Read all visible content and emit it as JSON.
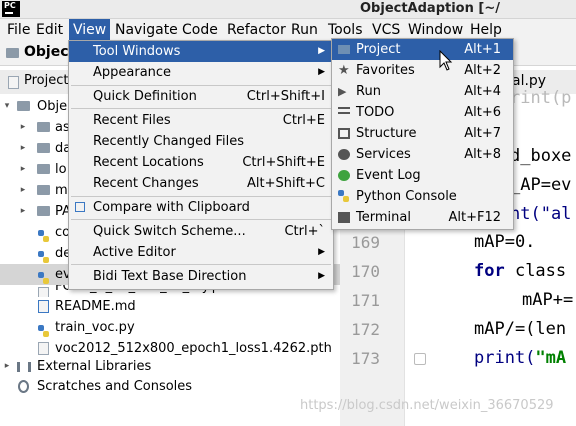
{
  "window": {
    "title": "ObjectAdaption [~/"
  },
  "menubar": {
    "items": [
      "File",
      "Edit",
      "View",
      "Navigate",
      "Code",
      "Refactor",
      "Run",
      "Tools",
      "VCS",
      "Window",
      "Help"
    ],
    "active": "View"
  },
  "navbar": {
    "project_label": "Objec"
  },
  "project_panel": {
    "header": "Project",
    "rows": [
      {
        "label": "Obje",
        "kind": "folder",
        "indent": 0,
        "arrow": "▾"
      },
      {
        "label": "as",
        "kind": "folder",
        "indent": 1,
        "arrow": "▸"
      },
      {
        "label": "da",
        "kind": "folder",
        "indent": 1,
        "arrow": "▸"
      },
      {
        "label": "lo",
        "kind": "folder",
        "indent": 1,
        "arrow": "▸"
      },
      {
        "label": "m",
        "kind": "folder",
        "indent": 1,
        "arrow": "▸"
      },
      {
        "label": "PA",
        "kind": "folder",
        "indent": 1,
        "arrow": "▸"
      },
      {
        "label": "co",
        "kind": "py",
        "indent": 1,
        "arrow": ""
      },
      {
        "label": "de",
        "kind": "py",
        "indent": 1,
        "arrow": ""
      },
      {
        "label": "ev",
        "kind": "py",
        "indent": 1,
        "arrow": "",
        "selected": true
      },
      {
        "label": "FCOS_R_50_FPN_1x_my.pth",
        "kind": "file",
        "indent": 1,
        "arrow": ""
      },
      {
        "label": "README.md",
        "kind": "md",
        "indent": 1,
        "arrow": ""
      },
      {
        "label": "train_voc.py",
        "kind": "py",
        "indent": 1,
        "arrow": ""
      },
      {
        "label": "voc2012_512x800_epoch1_loss1.4262.pth",
        "kind": "file",
        "indent": 1,
        "arrow": ""
      },
      {
        "label": "External Libraries",
        "kind": "lib",
        "indent": 0,
        "arrow": "▸"
      },
      {
        "label": "Scratches and Consoles",
        "kind": "scratch",
        "indent": 0,
        "arrow": ""
      }
    ]
  },
  "editor": {
    "tab_label": "al.py",
    "line_numbers": [
      "169",
      "170",
      "171",
      "172",
      "173"
    ],
    "partial_lines": [
      "rint(p",
      "d_boxe",
      "_AP=ev",
      "nt(\"al"
    ],
    "code": {
      "l169": "mAP=0.",
      "l170_kw": "for ",
      "l170": "class",
      "l171": "mAP+=",
      "l172": "mAP/=(len",
      "l173_fn": "print(",
      "l173_str": "\"mA"
    }
  },
  "view_menu": {
    "items": [
      {
        "label": "Tool Windows",
        "shortcut": "",
        "submenu": true,
        "highlighted": true
      },
      {
        "label": "Appearance",
        "shortcut": "",
        "submenu": true
      },
      {
        "label": "Quick Definition",
        "shortcut": "Ctrl+Shift+I"
      },
      {
        "label": "Recent Files",
        "shortcut": "Ctrl+E"
      },
      {
        "label": "Recently Changed Files",
        "shortcut": ""
      },
      {
        "label": "Recent Locations",
        "shortcut": "Ctrl+Shift+E"
      },
      {
        "label": "Recent Changes",
        "shortcut": "Alt+Shift+C"
      },
      {
        "label": "Compare with Clipboard",
        "shortcut": ""
      },
      {
        "label": "Quick Switch Scheme...",
        "shortcut": "Ctrl+`"
      },
      {
        "label": "Active Editor",
        "shortcut": "",
        "submenu": true
      },
      {
        "label": "Bidi Text Base Direction",
        "shortcut": "",
        "submenu": true
      }
    ]
  },
  "tool_windows_menu": {
    "items": [
      {
        "label": "Project",
        "shortcut": "Alt+1",
        "icon": "folder-icon",
        "highlighted": true
      },
      {
        "label": "Favorites",
        "shortcut": "Alt+2",
        "icon": "star-icon"
      },
      {
        "label": "Run",
        "shortcut": "Alt+4",
        "icon": "run-icon"
      },
      {
        "label": "TODO",
        "shortcut": "Alt+6",
        "icon": "todo-icon"
      },
      {
        "label": "Structure",
        "shortcut": "Alt+7",
        "icon": "structure-icon"
      },
      {
        "label": "Services",
        "shortcut": "Alt+8",
        "icon": "services-icon"
      },
      {
        "label": "Event Log",
        "shortcut": "",
        "icon": "event-log-icon"
      },
      {
        "label": "Python Console",
        "shortcut": "",
        "icon": "python-console-icon"
      },
      {
        "label": "Terminal",
        "shortcut": "Alt+F12",
        "icon": "terminal-icon"
      }
    ]
  },
  "watermark": "https://blog.csdn.net/weixin_36670529",
  "colors": {
    "highlight": "#2d5fa8",
    "menu_bg": "#f2f2f2"
  }
}
